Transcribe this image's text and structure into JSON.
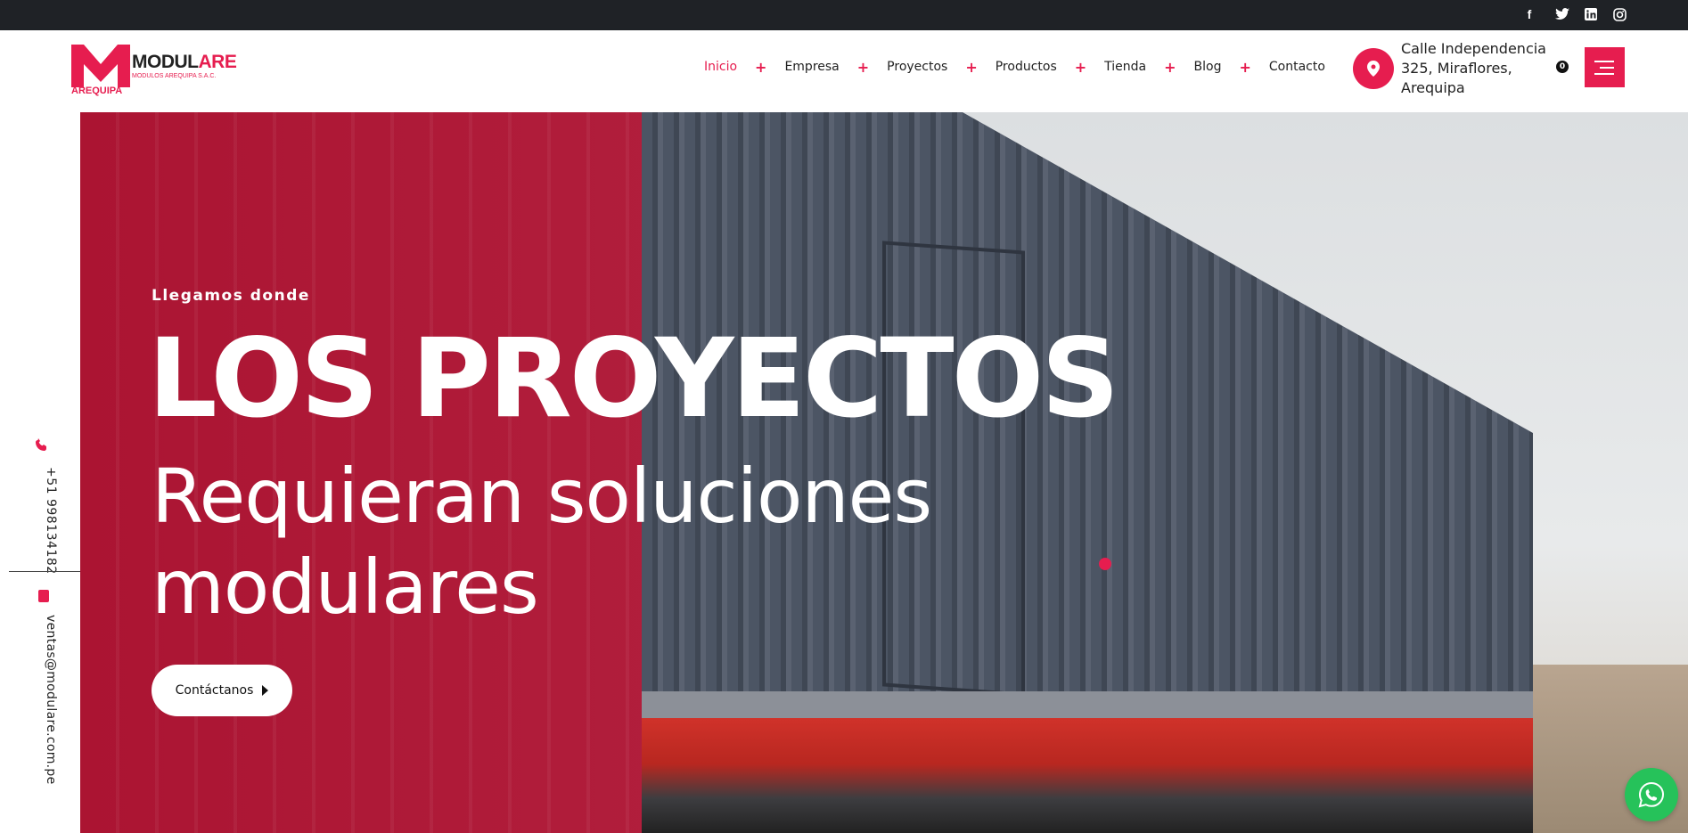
{
  "topbar": {
    "social": [
      {
        "icon": "facebook-icon",
        "glyph": "f"
      },
      {
        "icon": "twitter-icon",
        "glyph": "t"
      },
      {
        "icon": "linkedin-icon",
        "glyph": "in"
      },
      {
        "icon": "instagram-icon",
        "glyph": "◎"
      }
    ]
  },
  "header": {
    "logo": {
      "word_a": "MODUL",
      "word_b": "ARE",
      "sub": "MODULOS AREQUIPA S.A.C.",
      "city": "AREQUIPA"
    },
    "nav": [
      {
        "label": "Inicio",
        "active": true
      },
      {
        "label": "Empresa"
      },
      {
        "label": "Proyectos"
      },
      {
        "label": "Productos"
      },
      {
        "label": "Tienda"
      },
      {
        "label": "Blog"
      },
      {
        "label": "Contacto"
      }
    ],
    "address": "Calle Independencia 325, Miraflores, Arequipa",
    "cart_count": "0"
  },
  "sidebar": {
    "phone": "+51 998134182",
    "email": "ventas@modulare.com.pe"
  },
  "hero": {
    "pretitle": "Llegamos donde",
    "title": "LOS PROYECTOS",
    "subtitle": "Requieran soluciones modulares",
    "cta_label": "Contáctanos"
  },
  "colors": {
    "accent": "#e61d4f",
    "topbar": "#1f2226",
    "whatsapp": "#26c25a"
  }
}
